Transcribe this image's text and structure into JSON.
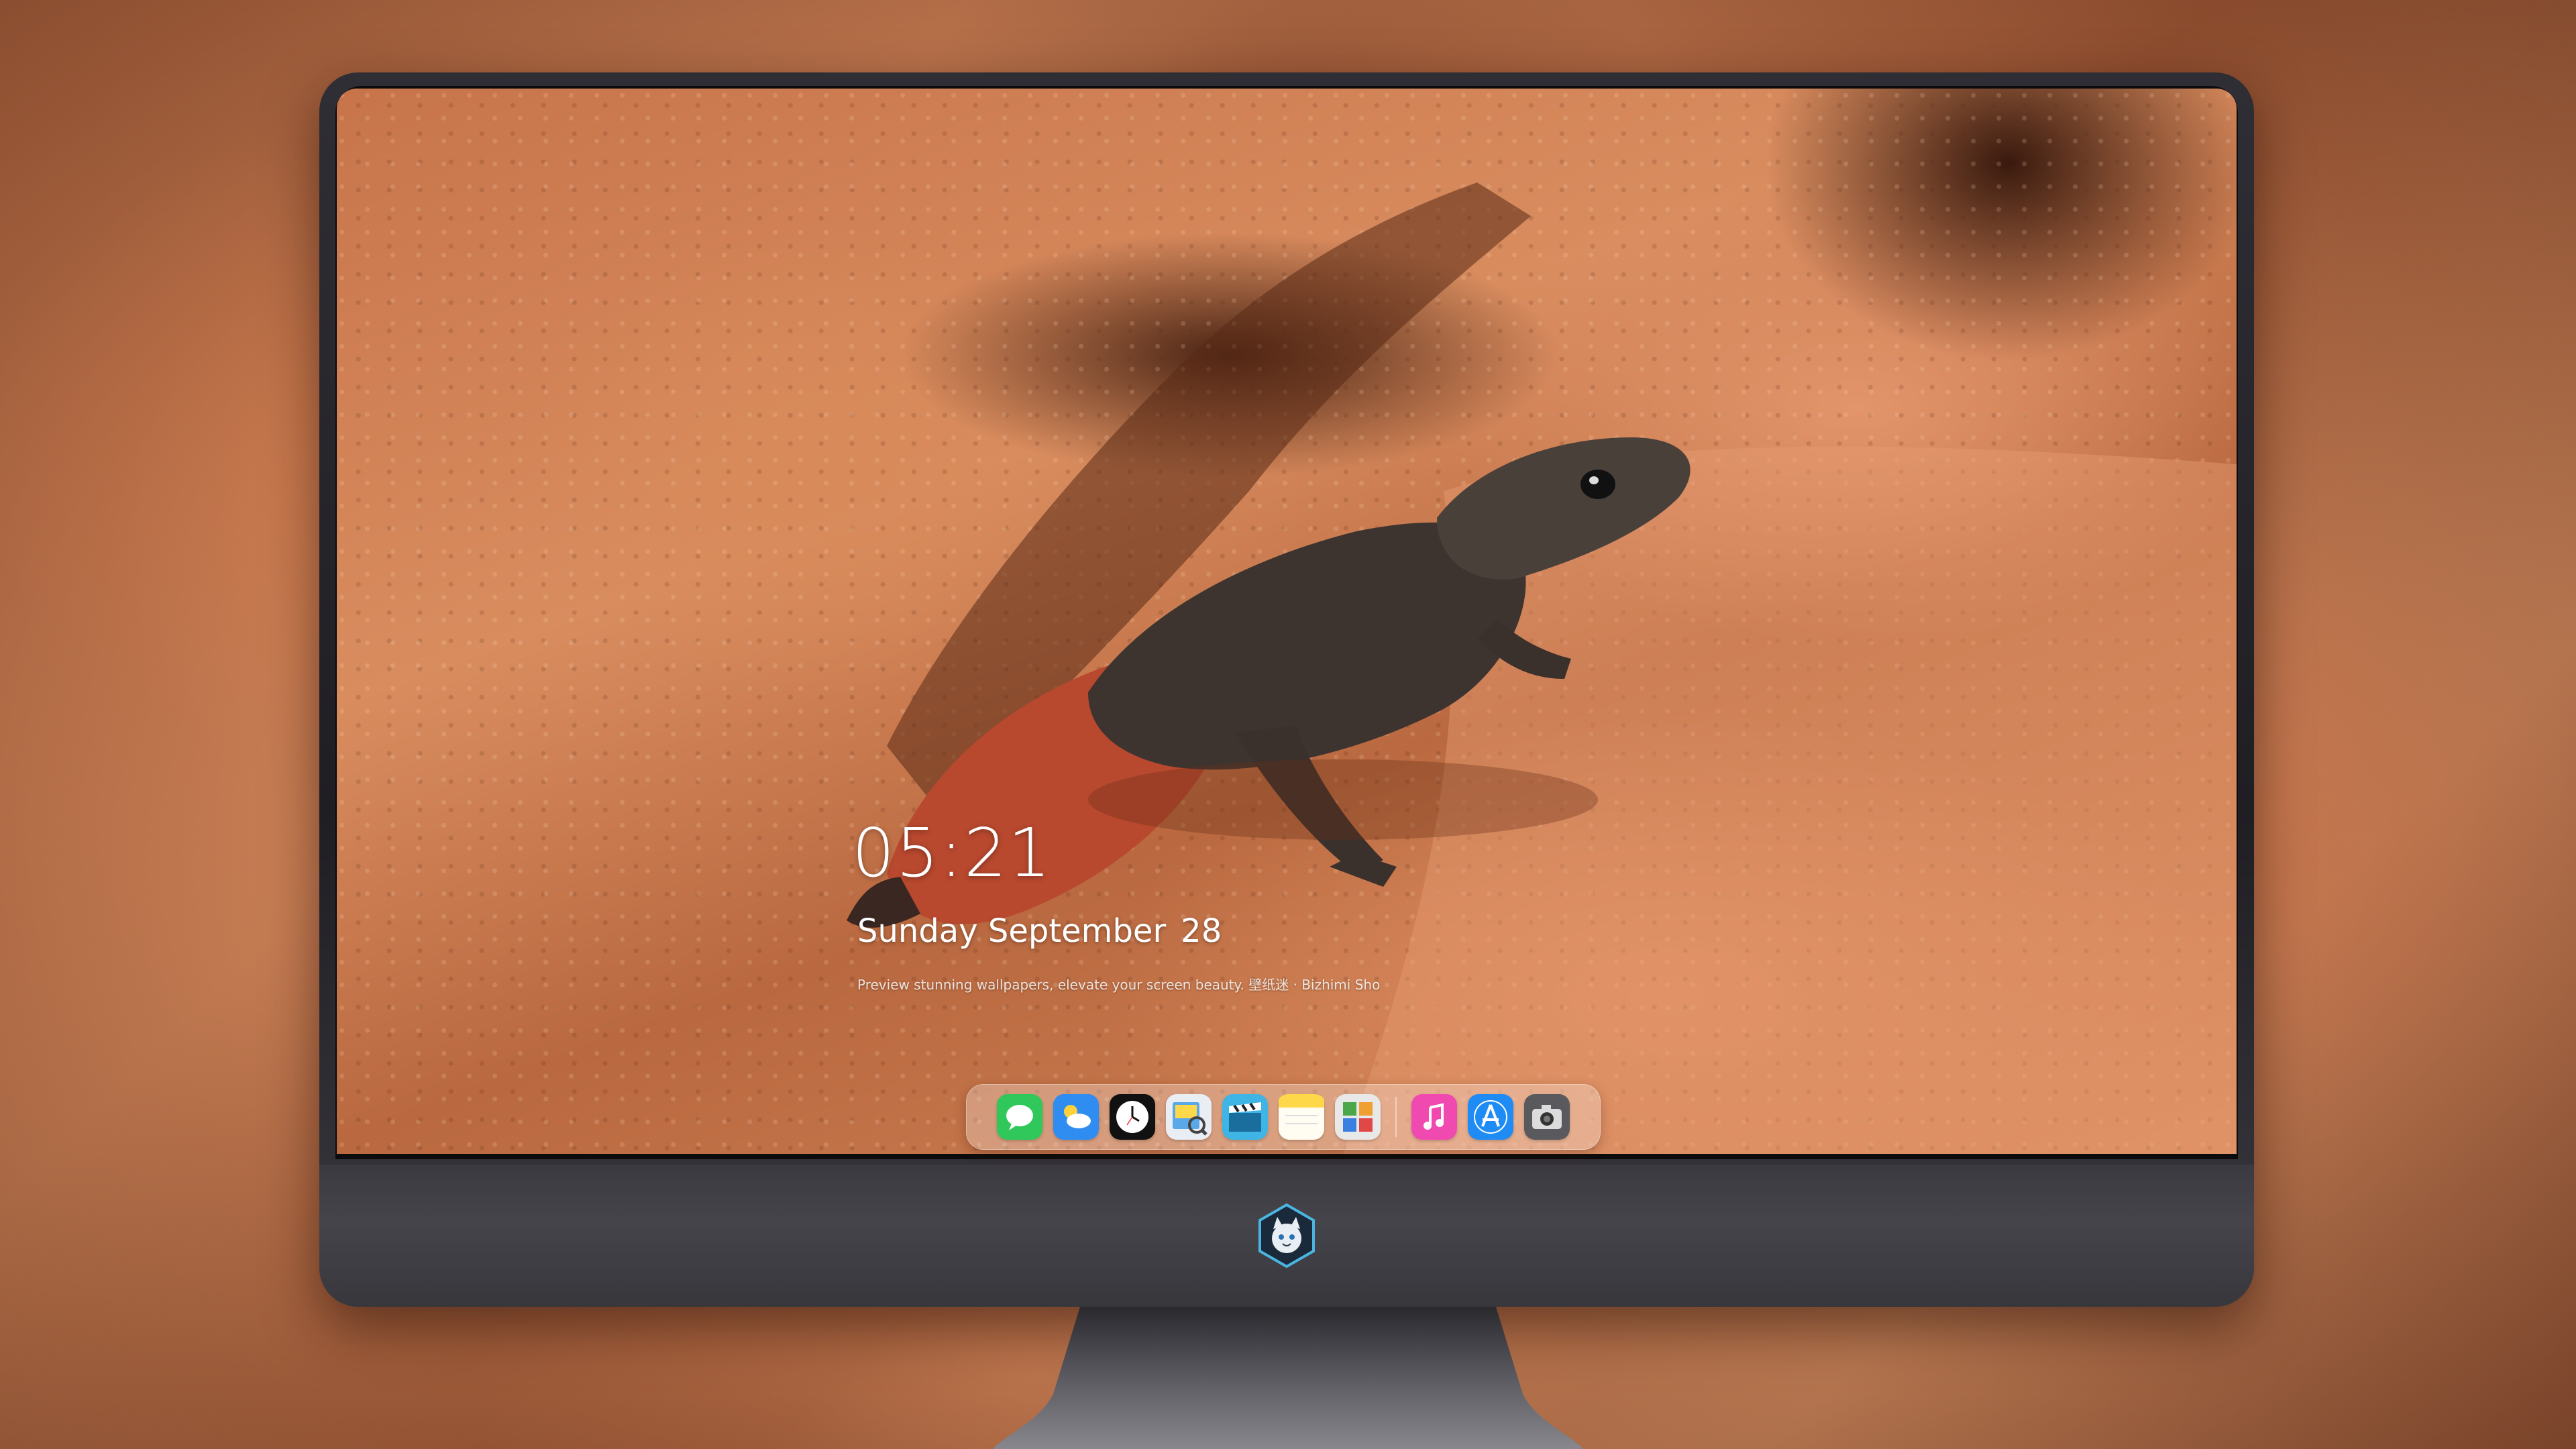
{
  "lock_screen": {
    "time": "05:21",
    "date_weekday_month": "Sunday September",
    "date_day": "28",
    "caption": "Preview stunning wallpapers, elevate your screen beauty. 壁纸迷 · Bizhimi Sho"
  },
  "dock": {
    "apps": [
      {
        "name": "Messages",
        "icon": "messages-icon",
        "color": "#30c85a"
      },
      {
        "name": "Weather",
        "icon": "weather-icon",
        "color": "#2f8cf0"
      },
      {
        "name": "Clock",
        "icon": "clock-icon",
        "color": "#111111"
      },
      {
        "name": "Preview",
        "icon": "preview-icon",
        "color": "#5aa8e8"
      },
      {
        "name": "Final Cut",
        "icon": "clapper-icon",
        "color": "#3fb5e6"
      },
      {
        "name": "Notes",
        "icon": "notes-icon",
        "color": "#ffd84a"
      },
      {
        "name": "Photo Booth",
        "icon": "photobooth-icon",
        "color": "#e8e8e8"
      },
      {
        "name": "Music",
        "icon": "music-icon",
        "color": "#f04ab0"
      },
      {
        "name": "App Store",
        "icon": "appstore-icon",
        "color": "#1f8cf5"
      },
      {
        "name": "Camera",
        "icon": "camera-icon",
        "color": "#5a5a5e"
      }
    ]
  },
  "monitor": {
    "logo": "fox-mascot-logo"
  },
  "colors": {
    "rock": "#d98d5f",
    "lizard_body": "#3d3430",
    "lizard_tail": "#b8482e"
  }
}
